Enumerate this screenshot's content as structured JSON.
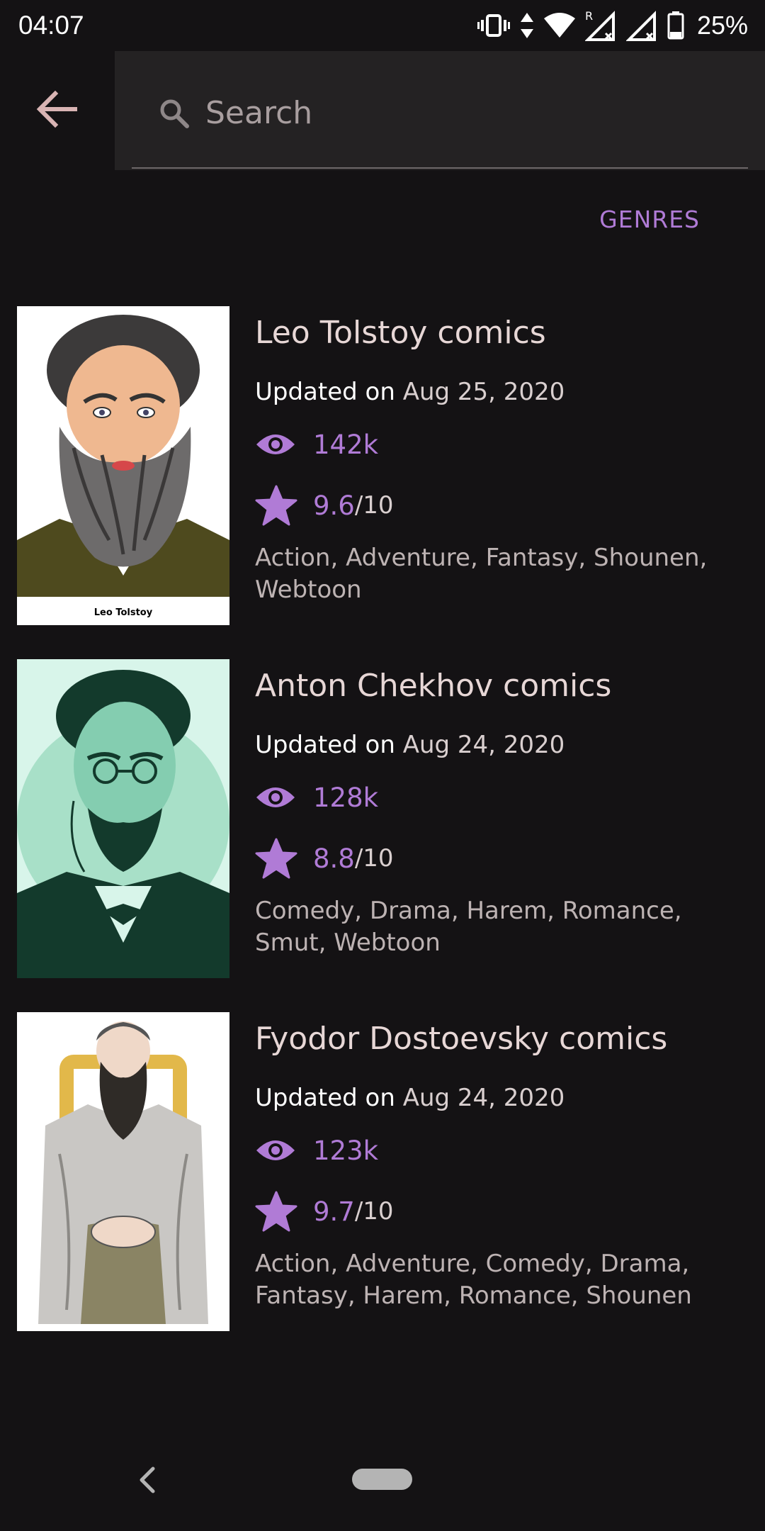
{
  "status_bar": {
    "time": "04:07",
    "battery": "25%",
    "icons": [
      "vibrate-icon",
      "data-arrows-icon",
      "wifi-icon",
      "signal-roaming-icon",
      "signal-icon",
      "battery-icon"
    ]
  },
  "toolbar": {
    "back_icon": "arrow-left-icon",
    "search_placeholder": "Search",
    "search_value": "",
    "genres_label": "GENRES"
  },
  "comics": [
    {
      "title": "Leo Tolstoy comics",
      "updated_label": "Updated on",
      "updated_date": "Aug 25, 2020",
      "views": "142k",
      "rating": "9.6",
      "rating_max": "/10",
      "genres": "Action, Adventure, Fantasy, Shounen, Webtoon",
      "cover_caption": "Leo Tolstoy"
    },
    {
      "title": "Anton Chekhov comics",
      "updated_label": "Updated on",
      "updated_date": "Aug 24, 2020",
      "views": "128k",
      "rating": "8.8",
      "rating_max": "/10",
      "genres": "Comedy, Drama, Harem, Romance, Smut, Webtoon"
    },
    {
      "title": "Fyodor Dostoevsky comics",
      "updated_label": "Updated on",
      "updated_date": "Aug 24, 2020",
      "views": "123k",
      "rating": "9.7",
      "rating_max": "/10",
      "genres": "Action, Adventure, Comedy, Drama, Fantasy, Harem, Romance, Shounen"
    }
  ],
  "colors": {
    "background": "#141214",
    "accent": "#b07bd6",
    "search_bg": "#242223"
  }
}
